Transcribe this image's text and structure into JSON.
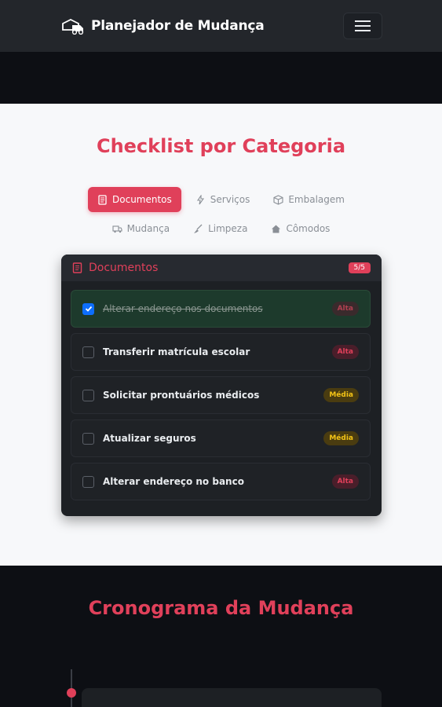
{
  "navbar": {
    "brand_icon": "moving-truck-icon",
    "brand": "Planejador de Mudança",
    "menu_icon": "hamburger-menu-icon"
  },
  "checklist": {
    "title": "Checklist por Categoria",
    "tabs": [
      {
        "label": "Documentos",
        "icon": "document-icon",
        "active": true
      },
      {
        "label": "Serviços",
        "icon": "bolt-icon",
        "active": false
      },
      {
        "label": "Embalagem",
        "icon": "box-icon",
        "active": false
      },
      {
        "label": "Mudança",
        "icon": "truck-icon",
        "active": false
      },
      {
        "label": "Limpeza",
        "icon": "broom-icon",
        "active": false
      },
      {
        "label": "Cômodos",
        "icon": "home-icon",
        "active": false
      }
    ],
    "card": {
      "title": "Documentos",
      "icon": "document-icon",
      "count": "5/5",
      "tasks": [
        {
          "label": "Alterar endereço nos documentos",
          "priority": "Alta",
          "checked": true
        },
        {
          "label": "Transferir matrícula escolar",
          "priority": "Alta",
          "checked": false
        },
        {
          "label": "Solicitar prontuários médicos",
          "priority": "Média",
          "checked": false
        },
        {
          "label": "Atualizar seguros",
          "priority": "Média",
          "checked": false
        },
        {
          "label": "Alterar endereço no banco",
          "priority": "Alta",
          "checked": false
        }
      ]
    }
  },
  "timeline": {
    "title": "Cronograma da Mudança"
  },
  "colors": {
    "accent": "#e0405a",
    "priority_alta": "#e0405a",
    "priority_media": "#f3c316",
    "checkbox_checked": "#0d6efd"
  }
}
